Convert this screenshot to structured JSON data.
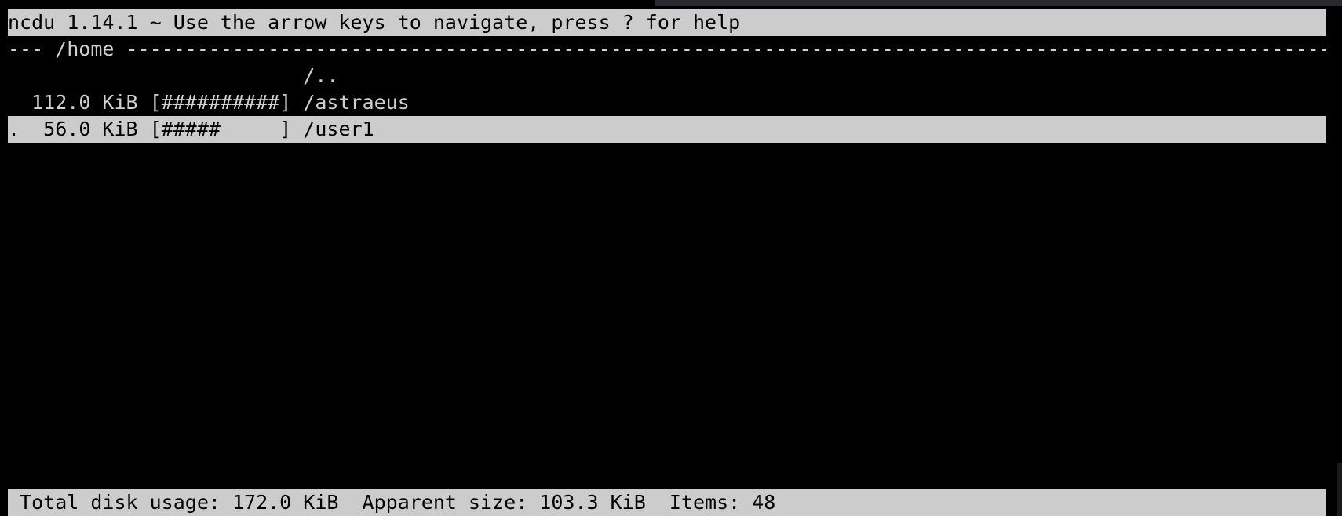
{
  "header": {
    "text": "ncdu 1.14.1 ~ Use the arrow keys to navigate, press ? for help"
  },
  "current_dir": {
    "text": "--- /home -------------------------------------------------------------------------------------------------------------------------------"
  },
  "parent_entry": {
    "text": "                         /.."
  },
  "entries": [
    {
      "flag": " ",
      "size": " 112.0 KiB",
      "bar": "[##########]",
      "name": "/astraeus",
      "selected": false
    },
    {
      "flag": ".",
      "size": "  56.0 KiB",
      "bar": "[#####     ]",
      "name": "/user1",
      "selected": true
    }
  ],
  "status": {
    "text": " Total disk usage: 172.0 KiB  Apparent size: 103.3 KiB  Items: 48"
  },
  "colors": {
    "background": "#000000",
    "foreground": "#d0d0d0",
    "inverse_bg": "#cccccc",
    "inverse_fg": "#000000"
  }
}
